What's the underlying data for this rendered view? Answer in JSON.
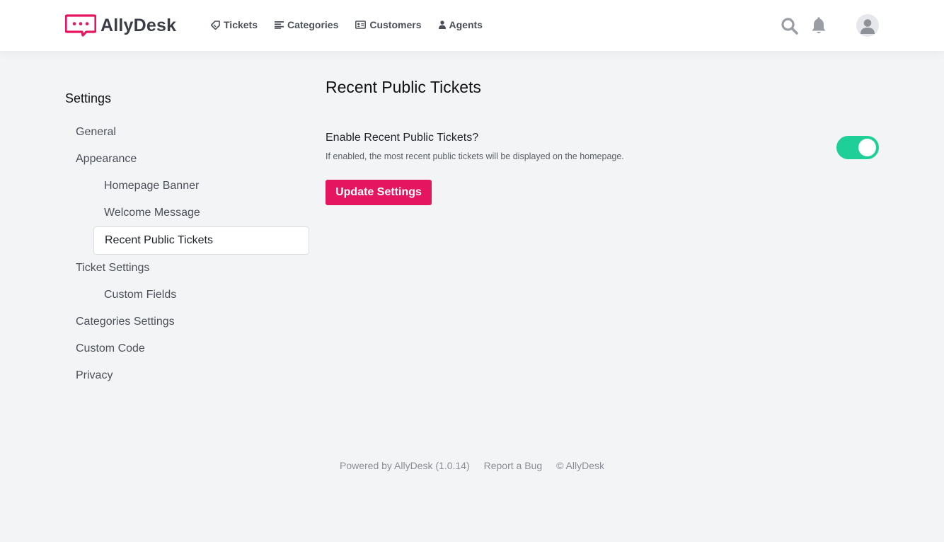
{
  "app": {
    "name": "AllyDesk"
  },
  "colors": {
    "accent": "#e5155f",
    "toggle_on": "#1fcf98",
    "background": "#f3f4f6"
  },
  "nav": {
    "items": [
      {
        "label": "Tickets",
        "icon": "ticket-icon"
      },
      {
        "label": "Categories",
        "icon": "list-icon"
      },
      {
        "label": "Customers",
        "icon": "id-card-icon"
      },
      {
        "label": "Agents",
        "icon": "user-icon"
      }
    ]
  },
  "topbar": {
    "icons": [
      "search-icon",
      "bell-icon",
      "avatar-icon"
    ]
  },
  "sidebar": {
    "title": "Settings",
    "items": [
      {
        "label": "General",
        "level": 1
      },
      {
        "label": "Appearance",
        "level": 1
      },
      {
        "label": "Homepage Banner",
        "level": 2
      },
      {
        "label": "Welcome Message",
        "level": 2
      },
      {
        "label": "Recent Public Tickets",
        "level": 2,
        "active": true
      },
      {
        "label": "Ticket Settings",
        "level": 1
      },
      {
        "label": "Custom Fields",
        "level": 2
      },
      {
        "label": "Categories Settings",
        "level": 1
      },
      {
        "label": "Custom Code",
        "level": 1
      },
      {
        "label": "Privacy",
        "level": 1
      }
    ]
  },
  "main": {
    "title": "Recent Public Tickets",
    "setting": {
      "label": "Enable Recent Public Tickets?",
      "help": "If enabled, the most recent public tickets will be displayed on the homepage.",
      "enabled": true
    },
    "submit_label": "Update Settings"
  },
  "footer": {
    "powered_by": "Powered by AllyDesk (1.0.14)",
    "report_bug": "Report a Bug",
    "copyright": "© AllyDesk"
  }
}
